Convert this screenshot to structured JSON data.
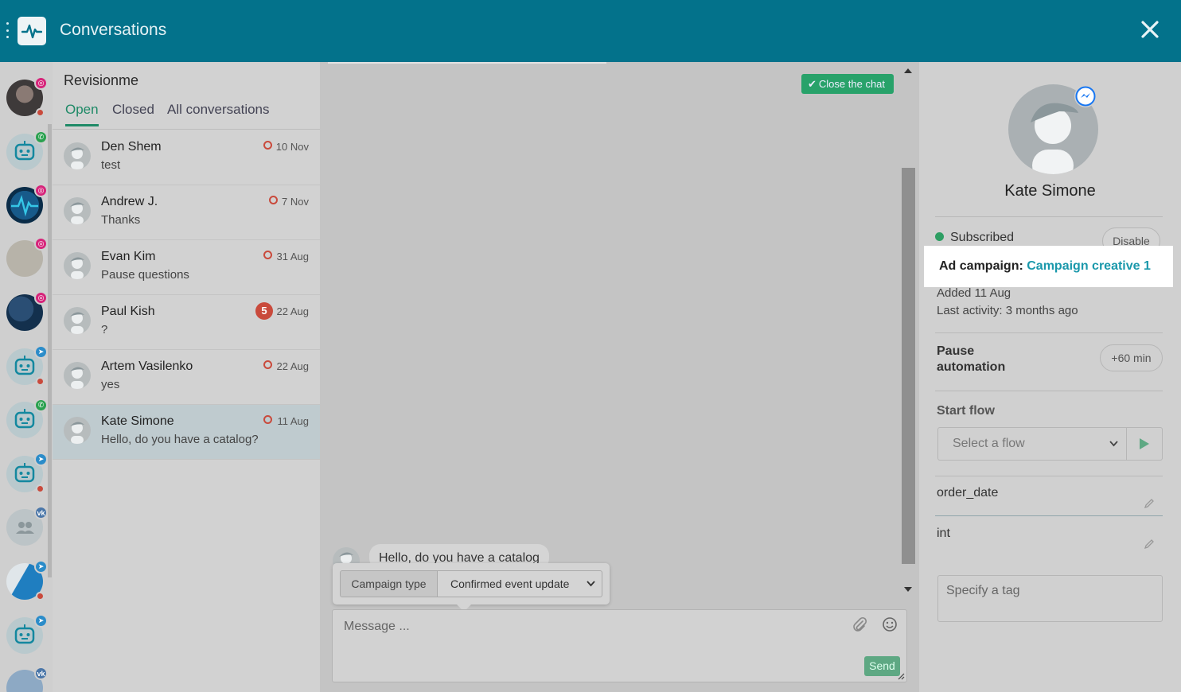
{
  "header": {
    "title": "Conversations"
  },
  "list": {
    "title": "Revisionme",
    "tabs": [
      {
        "label": "Open"
      },
      {
        "label": "Closed"
      },
      {
        "label": "All conversations"
      }
    ],
    "conversations": [
      {
        "name": "Den Shem",
        "message": "test",
        "date": "10 Nov"
      },
      {
        "name": "Andrew J.",
        "message": "Thanks",
        "date": "7 Nov"
      },
      {
        "name": "Evan Kim",
        "message": "Pause questions",
        "date": "31 Aug"
      },
      {
        "name": "Paul Kish",
        "message": "?",
        "date": "22 Aug",
        "unread": "5"
      },
      {
        "name": "Artem Vasilenko",
        "message": "yes",
        "date": "22 Aug"
      },
      {
        "name": "Kate Simone",
        "message": "Hello, do you have a catalog?",
        "date": "11 Aug"
      }
    ]
  },
  "chat": {
    "close_label": "Close the chat",
    "bubble_text": "Hello, do you have a catalog",
    "campaign_type_label": "Campaign type",
    "campaign_select_value": "Confirmed event update",
    "message_placeholder": "Message ...",
    "send_label": "Send"
  },
  "panel": {
    "name": "Kate Simone",
    "subscribed_label": "Subscribed",
    "disable_label": "Disable",
    "ad_campaign_label": "Ad campaign:",
    "ad_campaign_value": "Campaign creative 1",
    "added": "Added 11 Aug",
    "last_activity": "Last activity: 3 months ago",
    "pause_label": "Pause automation",
    "pause_button": "+60 min",
    "start_flow_label": "Start flow",
    "flow_placeholder": "Select a flow",
    "fields": [
      {
        "name": "order_date"
      },
      {
        "name": "int"
      }
    ],
    "tag_placeholder": "Specify a tag"
  },
  "colors": {
    "header": "#03728b",
    "accent_green": "#28a26a",
    "link": "#1a98ab",
    "alert_red": "#c94a3c"
  }
}
